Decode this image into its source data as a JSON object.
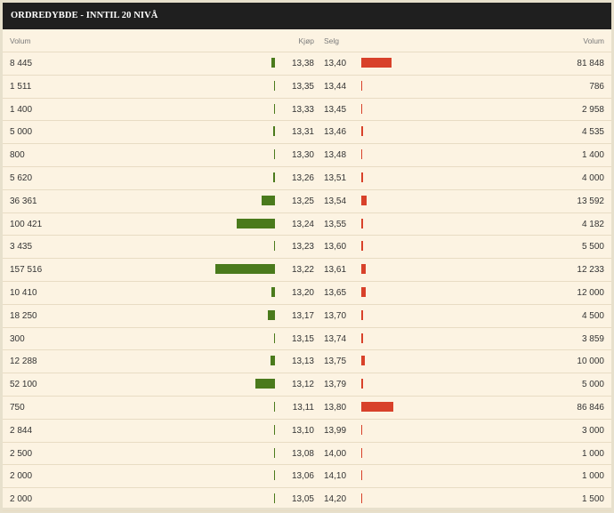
{
  "title": "ORDREDYBDE - INNTIL 20 NIVÅ",
  "columns": {
    "bid_volume": "Volum",
    "bid": "Kjøp",
    "ask": "Selg",
    "ask_volume": "Volum"
  },
  "colors": {
    "header_bg": "#1f1f1f",
    "panel_bg": "#fcf3e2",
    "bid_bar": "#4a7a1c",
    "ask_bar": "#d8412a"
  },
  "rows": [
    {
      "bid_volume": "8 445",
      "bid": "13,38",
      "ask": "13,40",
      "ask_volume": "81 848"
    },
    {
      "bid_volume": "1 511",
      "bid": "13,35",
      "ask": "13,44",
      "ask_volume": "786"
    },
    {
      "bid_volume": "1 400",
      "bid": "13,33",
      "ask": "13,45",
      "ask_volume": "2 958"
    },
    {
      "bid_volume": "5 000",
      "bid": "13,31",
      "ask": "13,46",
      "ask_volume": "4 535"
    },
    {
      "bid_volume": "800",
      "bid": "13,30",
      "ask": "13,48",
      "ask_volume": "1 400"
    },
    {
      "bid_volume": "5 620",
      "bid": "13,26",
      "ask": "13,51",
      "ask_volume": "4 000"
    },
    {
      "bid_volume": "36 361",
      "bid": "13,25",
      "ask": "13,54",
      "ask_volume": "13 592"
    },
    {
      "bid_volume": "100 421",
      "bid": "13,24",
      "ask": "13,55",
      "ask_volume": "4 182"
    },
    {
      "bid_volume": "3 435",
      "bid": "13,23",
      "ask": "13,60",
      "ask_volume": "5 500"
    },
    {
      "bid_volume": "157 516",
      "bid": "13,22",
      "ask": "13,61",
      "ask_volume": "12 233"
    },
    {
      "bid_volume": "10 410",
      "bid": "13,20",
      "ask": "13,65",
      "ask_volume": "12 000"
    },
    {
      "bid_volume": "18 250",
      "bid": "13,17",
      "ask": "13,70",
      "ask_volume": "4 500"
    },
    {
      "bid_volume": "300",
      "bid": "13,15",
      "ask": "13,74",
      "ask_volume": "3 859"
    },
    {
      "bid_volume": "12 288",
      "bid": "13,13",
      "ask": "13,75",
      "ask_volume": "10 000"
    },
    {
      "bid_volume": "52 100",
      "bid": "13,12",
      "ask": "13,79",
      "ask_volume": "5 000"
    },
    {
      "bid_volume": "750",
      "bid": "13,11",
      "ask": "13,80",
      "ask_volume": "86 846"
    },
    {
      "bid_volume": "2 844",
      "bid": "13,10",
      "ask": "13,99",
      "ask_volume": "3 000"
    },
    {
      "bid_volume": "2 500",
      "bid": "13,08",
      "ask": "14,00",
      "ask_volume": "1 000"
    },
    {
      "bid_volume": "2 000",
      "bid": "13,06",
      "ask": "14,10",
      "ask_volume": "1 000"
    },
    {
      "bid_volume": "2 000",
      "bid": "13,05",
      "ask": "14,20",
      "ask_volume": "1 500"
    }
  ]
}
